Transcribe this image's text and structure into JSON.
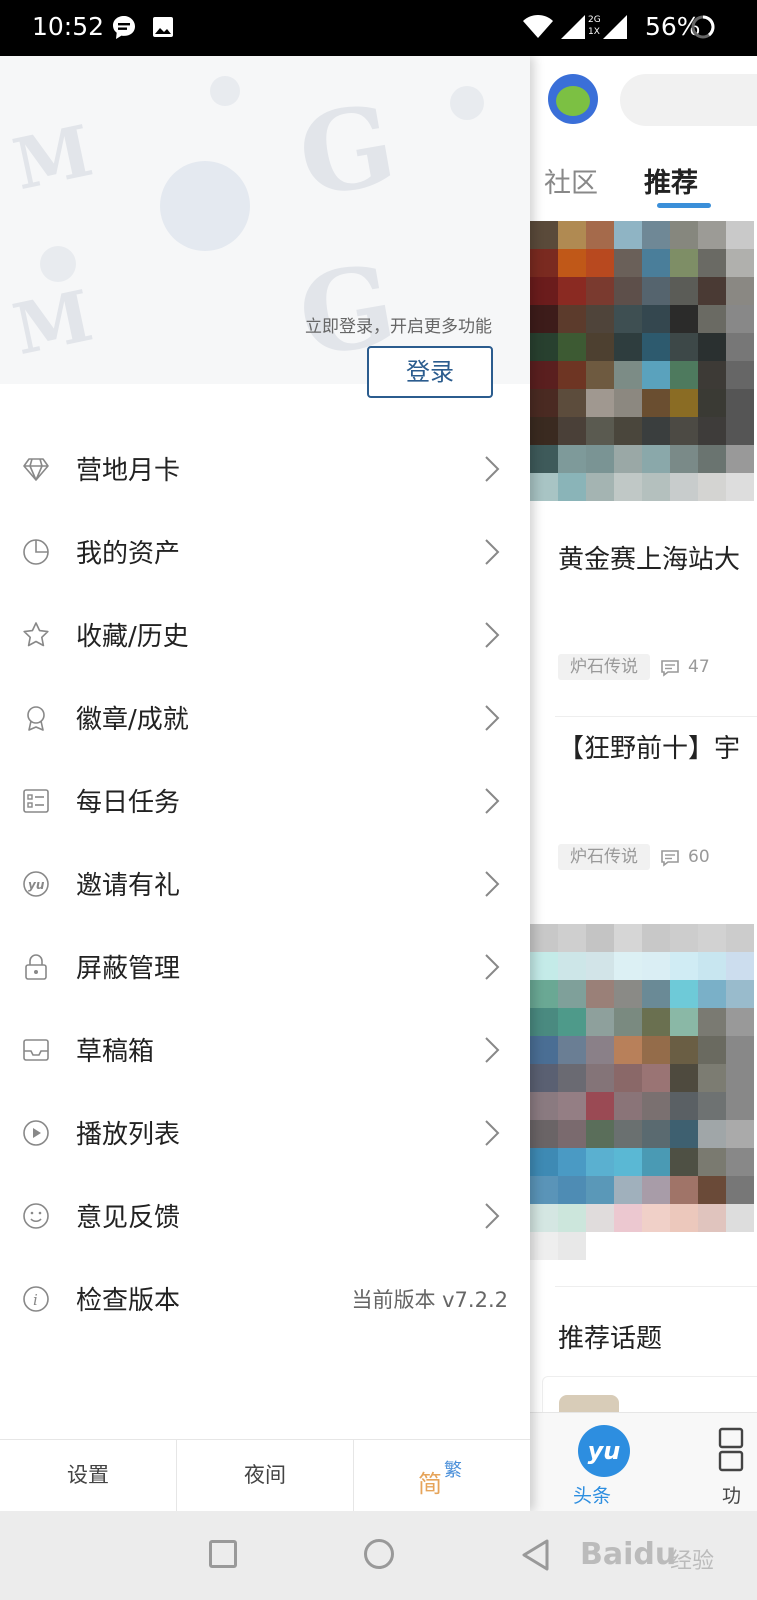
{
  "status_bar": {
    "time": "10:52",
    "battery_percent": "56%",
    "network_labels": "2G 1X"
  },
  "feed": {
    "tabs": [
      {
        "label": "社区",
        "active": false
      },
      {
        "label": "推荐",
        "active": true
      }
    ],
    "cards": [
      {
        "title": "黄金赛上海站大",
        "tag": "炉石传说",
        "comments": "47"
      },
      {
        "title": "【狂野前十】宇",
        "tag": "炉石传说",
        "comments": "60"
      }
    ],
    "section_title": "推荐话题",
    "bottom_nav": [
      {
        "label": "头条",
        "icon": "yu-logo-icon",
        "color": "#2d8ee0",
        "logo_text": "yu"
      },
      {
        "label": "功",
        "icon": "grid-icon"
      }
    ]
  },
  "drawer": {
    "login_hint": "立即登录，开启更多功能",
    "login_button": "登录",
    "menu": [
      {
        "label": "营地月卡",
        "icon": "diamond-icon"
      },
      {
        "label": "我的资产",
        "icon": "pie-chart-icon"
      },
      {
        "label": "收藏/历史",
        "icon": "star-icon"
      },
      {
        "label": "徽章/成就",
        "icon": "badge-icon"
      },
      {
        "label": "每日任务",
        "icon": "checklist-icon"
      },
      {
        "label": "邀请有礼",
        "icon": "yu-circle-icon"
      },
      {
        "label": "屏蔽管理",
        "icon": "lock-icon"
      },
      {
        "label": "草稿箱",
        "icon": "inbox-icon"
      },
      {
        "label": "播放列表",
        "icon": "play-circle-icon"
      },
      {
        "label": "意见反馈",
        "icon": "smile-icon"
      },
      {
        "label": "检查版本",
        "icon": "info-icon",
        "value": "当前版本 v7.2.2"
      }
    ],
    "bottom": {
      "settings": "设置",
      "night": "夜间",
      "lang_simplified": "简",
      "lang_traditional": "繁"
    }
  },
  "colors": {
    "accent_blue": "#3b8fd9",
    "login_border": "#2b5c8e",
    "status_bar_bg": "#000000"
  },
  "watermark": {
    "text": "Baidu",
    "sub": "经验"
  }
}
